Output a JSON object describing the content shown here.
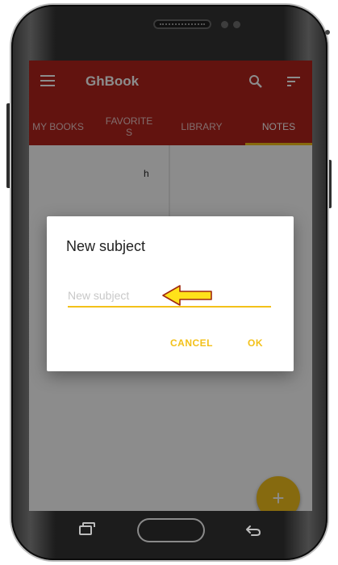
{
  "app": {
    "title": "GhBook"
  },
  "tabs": [
    {
      "label": "MY BOOKS"
    },
    {
      "label": "FAVORITE\nS"
    },
    {
      "label": "LIBRARY"
    },
    {
      "label": "NOTES"
    }
  ],
  "notes": {
    "first_card_text": "h"
  },
  "dialog": {
    "title": "New subject",
    "input_value": "",
    "input_placeholder": "New subject",
    "cancel_label": "CANCEL",
    "ok_label": "OK"
  },
  "fab": {
    "label": "+"
  },
  "colors": {
    "appbar": "#b2231c",
    "accent": "#f3c11a",
    "arrow_fill": "#ffe21a",
    "arrow_stroke": "#a02a10"
  }
}
